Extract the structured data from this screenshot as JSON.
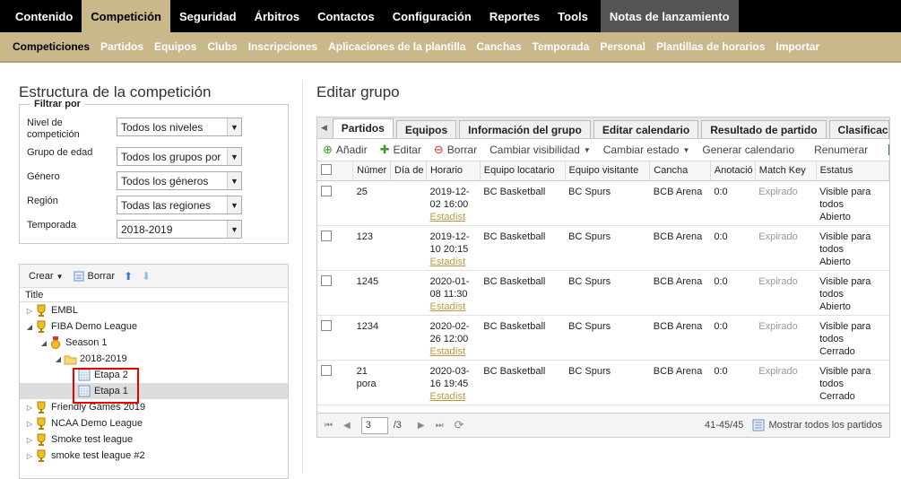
{
  "topnav": {
    "items": [
      "Contenido",
      "Competición",
      "Seguridad",
      "Árbitros",
      "Contactos",
      "Configuración",
      "Reportes",
      "Tools",
      "Notas de lanzamiento"
    ],
    "active": "Competición"
  },
  "subnav": {
    "items": [
      "Competiciones",
      "Partidos",
      "Equipos",
      "Clubs",
      "Inscripciones",
      "Aplicaciones de la plantilla",
      "Canchas",
      "Temporada",
      "Personal",
      "Plantillas de horarios",
      "Importar"
    ],
    "active": "Competiciones"
  },
  "left": {
    "title": "Estructura de la competición",
    "filter_legend": "Filtrar por",
    "filters": [
      {
        "label": "Nivel de competición",
        "value": "Todos los niveles"
      },
      {
        "label": "Grupo de edad",
        "value": "Todos los grupos por"
      },
      {
        "label": "Género",
        "value": "Todos los géneros"
      },
      {
        "label": "Región",
        "value": "Todas las regiones"
      },
      {
        "label": "Temporada",
        "value": "2018-2019"
      }
    ],
    "tree_toolbar": {
      "create": "Crear",
      "delete": "Borrar"
    },
    "tree_header": "Title",
    "tree": [
      {
        "label": "EMBL"
      },
      {
        "label": "FIBA Demo League"
      },
      {
        "label": "Season 1"
      },
      {
        "label": "2018-2019"
      },
      {
        "label": "Etapa 2"
      },
      {
        "label": "Etapa 1"
      },
      {
        "label": "Friendly Games 2019"
      },
      {
        "label": "NCAA Demo League"
      },
      {
        "label": "Smoke test league"
      },
      {
        "label": "smoke test league #2"
      }
    ]
  },
  "right": {
    "title": "Editar grupo",
    "tabs": [
      "Partidos",
      "Equipos",
      "Información del grupo",
      "Editar calendario",
      "Resultado de partido",
      "Clasificaci"
    ],
    "toolbar": {
      "add": "Añadir",
      "edit": "Editar",
      "delete": "Borrar",
      "visibility": "Cambiar visibilidad",
      "status": "Cambiar estado",
      "calendar": "Generar calendario",
      "renumber": "Renumerar"
    },
    "columns": [
      "Númer",
      "Día de",
      "Horario",
      "Equipo locatario",
      "Equipo visitante",
      "Cancha",
      "Anotació",
      "Match Key",
      "Estatus"
    ],
    "rows": [
      {
        "num": "25",
        "day": "",
        "date": "2019-12-",
        "time": "02 16:00",
        "stats": "Estadíst",
        "home": "BC Basketball",
        "away": "BC Spurs",
        "court": "BCB Arena",
        "score": "0:0",
        "key": "Expirado",
        "st1": "Visible para",
        "st2": "todos",
        "st3": "Abierto"
      },
      {
        "num": "123",
        "day": "",
        "date": "2019-12-",
        "time": "10 20:15",
        "stats": "Estadíst",
        "home": "BC Basketball",
        "away": "BC Spurs",
        "court": "BCB Arena",
        "score": "0:0",
        "key": "Expirado",
        "st1": "Visible para",
        "st2": "todos",
        "st3": "Abierto"
      },
      {
        "num": "1245",
        "day": "",
        "date": "2020-01-",
        "time": "08 11:30",
        "stats": "Estadíst",
        "home": "BC Basketball",
        "away": "BC Spurs",
        "court": "BCB Arena",
        "score": "0:0",
        "key": "Expirado",
        "st1": "Visible para",
        "st2": "todos",
        "st3": "Abierto"
      },
      {
        "num": "1234",
        "day": "",
        "date": "2020-02-",
        "time": "26 12:00",
        "stats": "Estadíst",
        "home": "BC Basketball",
        "away": "BC Spurs",
        "court": "BCB Arena",
        "score": "0:0",
        "key": "Expirado",
        "st1": "Visible para",
        "st2": "todos",
        "st3": "Cerrado"
      },
      {
        "num": "21 pora",
        "day": "",
        "date": "2020-03-",
        "time": "16 19:45",
        "stats": "Estadíst",
        "home": "BC Basketball",
        "away": "BC Spurs",
        "court": "BCB Arena",
        "score": "0:0",
        "key": "Expirado",
        "st1": "Visible para",
        "st2": "todos",
        "st3": "Cerrado"
      }
    ],
    "pager": {
      "page": "3",
      "total": "/3",
      "range": "41-45/45",
      "show_all": "Mostrar todos los partidos"
    }
  },
  "colors": {
    "accent": "#c8b88a",
    "nav": "#000000",
    "link": "#b89b3c",
    "highlight": "#ee0000"
  }
}
